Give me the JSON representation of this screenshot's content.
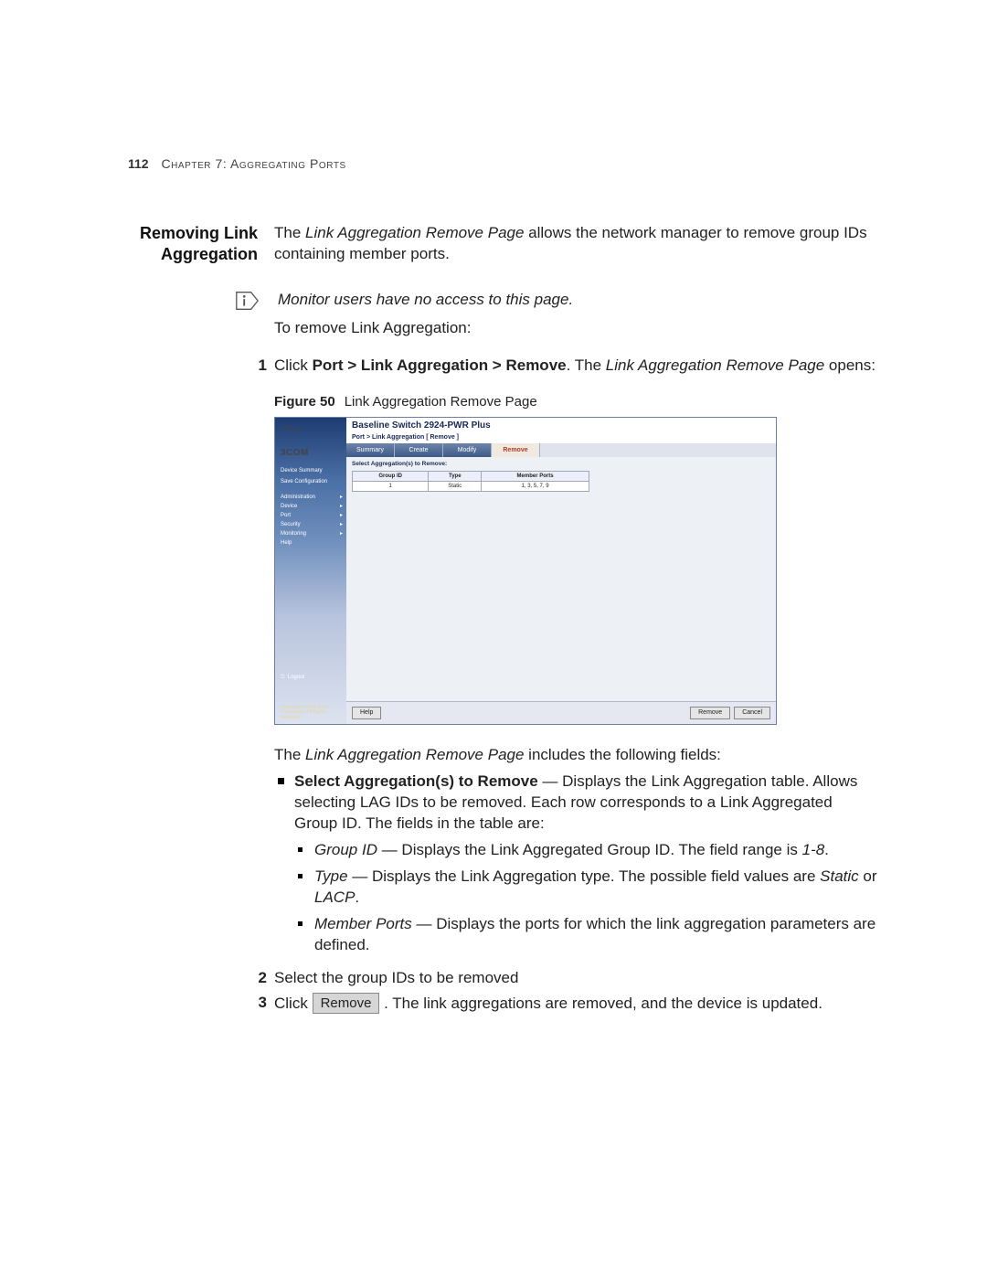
{
  "page_number": "112",
  "chapter_line": "Chapter 7: Aggregating Ports",
  "section_heading_l1": "Removing Link",
  "section_heading_l2": "Aggregation",
  "intro_pre": "The ",
  "intro_em": "Link Aggregation Remove Page",
  "intro_post": " allows the network manager to remove group IDs containing member ports.",
  "note_text": "Monitor users have no access to this page.",
  "intro2": "To remove Link Aggregation:",
  "step1_pre": "Click ",
  "step1_bold": "Port > Link Aggregation > Remove",
  "step1_mid": ". The ",
  "step1_em": "Link Aggregation Remove Page",
  "step1_post": " opens:",
  "fig_label": "Figure 50",
  "fig_caption": "Link Aggregation Remove Page",
  "screenshot": {
    "logo": "3COM",
    "links": [
      "Device Summary",
      "Save Configuration"
    ],
    "menu": [
      "Administration",
      "Device",
      "Port",
      "Security",
      "Monitoring",
      "Help"
    ],
    "logout": "Logout",
    "copyright": "Copyright © 2007\n3Com Corporation.\nAll Rights Reserved.",
    "header": "Baseline Switch 2924-PWR Plus",
    "breadcrumb": "Port > Link Aggregation [ Remove ]",
    "tabs": [
      "Summary",
      "Create",
      "Modify",
      "Remove"
    ],
    "tab_selected": 3,
    "select_label": "Select Aggregation(s) to Remove:",
    "cols": [
      "Group ID",
      "Type",
      "Member Ports"
    ],
    "row": {
      "group_id": "1",
      "type": "Static",
      "member_ports": "1, 3, 5, 7, 9"
    },
    "buttons": {
      "help": "Help",
      "remove": "Remove",
      "cancel": "Cancel"
    }
  },
  "after_fig_pre": "The ",
  "after_fig_em": "Link Aggregation Remove Page",
  "after_fig_post": " includes the following fields:",
  "b1_bold": "Select Aggregation(s) to Remove",
  "b1_rest": " — Displays the Link Aggregation table. Allows selecting LAG IDs to be removed. Each row corresponds to a Link Aggregated Group ID. The fields in the table are:",
  "sb1_em": "Group ID",
  "sb1_rest": " — Displays the Link Aggregated Group ID. The field range is ",
  "sb1_range": "1-8",
  "sb1_end": ".",
  "sb2_em": "Type",
  "sb2_rest": " — Displays the Link Aggregation type. The possible field values are ",
  "sb2_v1": "Static",
  "sb2_or": " or ",
  "sb2_v2": "LACP",
  "sb2_end": ".",
  "sb3_em": "Member Ports",
  "sb3_rest": " — Displays the ports for which the link aggregation parameters are defined.",
  "step2": "Select the group IDs to be removed",
  "step3_pre": "Click ",
  "step3_btn": "Remove",
  "step3_post": " . The link aggregations are removed, and the device is updated."
}
